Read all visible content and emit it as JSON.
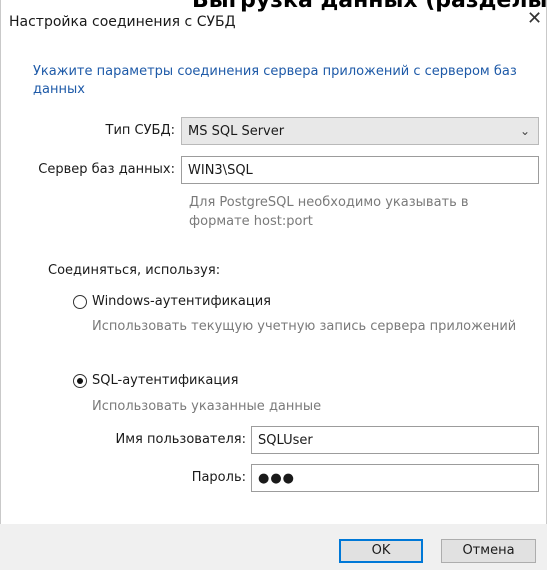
{
  "window": {
    "clipped_heading": "Выгрузка данных (разделы)",
    "title": "Настройка соединения с СУБД",
    "close_glyph": "✕"
  },
  "intro_text": "Укажите параметры соединения сервера приложений с сервером баз данных",
  "dbms": {
    "label": "Тип СУБД:",
    "value": "MS SQL Server",
    "arrow_glyph": "⌄"
  },
  "server": {
    "label": "Сервер баз данных:",
    "value": "WIN3\\SQL",
    "hint_line1": "Для PostgreSQL необходимо указывать в",
    "hint_line2": "формате host:port"
  },
  "connect_using": "Соединяться, используя:",
  "auth": {
    "windows": {
      "label": "Windows-аутентификация",
      "description": "Использовать текущую учетную запись сервера приложений",
      "selected": false
    },
    "sql": {
      "label": "SQL-аутентификация",
      "description": "Использовать указанные данные",
      "selected": true
    }
  },
  "username": {
    "label": "Имя пользователя:",
    "value": "SQLUser"
  },
  "password": {
    "label": "Пароль:",
    "value": "●●●"
  },
  "buttons": {
    "ok": "OK",
    "cancel": "Отмена"
  },
  "colors": {
    "accent_text": "#1e5aa8",
    "default_button_border": "#0078d7"
  }
}
